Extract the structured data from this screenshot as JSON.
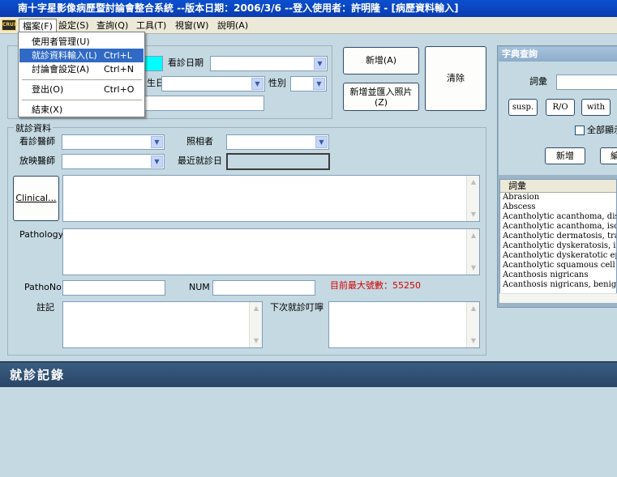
{
  "window": {
    "title": "南十字星影像病歷暨討論會整合系統 --版本日期：2006/3/6 --登入使用者：許明隆 - [病歷資料輸入]"
  },
  "menubar": {
    "items": [
      {
        "label": "檔案(F)"
      },
      {
        "label": "設定(S)"
      },
      {
        "label": "查詢(Q)"
      },
      {
        "label": "工具(T)"
      },
      {
        "label": "視窗(W)"
      },
      {
        "label": "說明(A)"
      }
    ]
  },
  "file_menu": {
    "items": [
      {
        "label": "使用者管理(U)",
        "shortcut": ""
      },
      {
        "label": "就診資料輸入(L)",
        "shortcut": "Ctrl+L"
      },
      {
        "label": "討論會設定(A)",
        "shortcut": "Ctrl+N"
      },
      {
        "label": "登出(O)",
        "shortcut": "Ctrl+O"
      },
      {
        "label": "結束(X)",
        "shortcut": ""
      }
    ]
  },
  "patient": {
    "visit_date_label": "看診日期",
    "birthdate_label": "生日",
    "gender_label": "性別"
  },
  "buttons": {
    "add": "新增(A)",
    "add_import_photos_line1": "新增並匯入照片",
    "add_import_photos_line2": "(Z)",
    "clear": "清除"
  },
  "visit": {
    "section_title": "就診資料",
    "doctor_label": "看診醫師",
    "photographer_label": "照相者",
    "radiologist_label": "放映醫師",
    "recent_visit_label": "最近就診日",
    "clinical_button": "Clinical...",
    "pathology_label": "Pathology",
    "pathno_label": "PathoNo",
    "num_label": "NUM",
    "max_number_text": "目前最大號數：55250",
    "note_label": "註記",
    "next_visit_label": "下次就診叮嚀"
  },
  "dictionary": {
    "title": "字典查詢",
    "vocab_label": "詞彙",
    "buttons": [
      "susp.",
      "R/O",
      "with"
    ],
    "all_label": "全部顯示",
    "add_button": "新增",
    "edit_button": "編輯",
    "list_header": "詞彙",
    "terms": [
      "Abrasion",
      "Abscess",
      "Acantholytic acanthoma, disseminated",
      "Acantholytic acanthoma, isolated",
      "Acantholytic dermatosis, transient",
      "Acantholytic dyskeratosis, incidental",
      "Acantholytic dyskeratotic epidermal nevus",
      "Acantholytic squamous cell carcinoma",
      "Acanthosis nigricans",
      "Acanthosis nigricans, benign inherited"
    ]
  },
  "records": {
    "title": "就診記錄"
  },
  "colors": {
    "accent_cyan": "#00ffff",
    "max_number_red": "#d40000"
  }
}
